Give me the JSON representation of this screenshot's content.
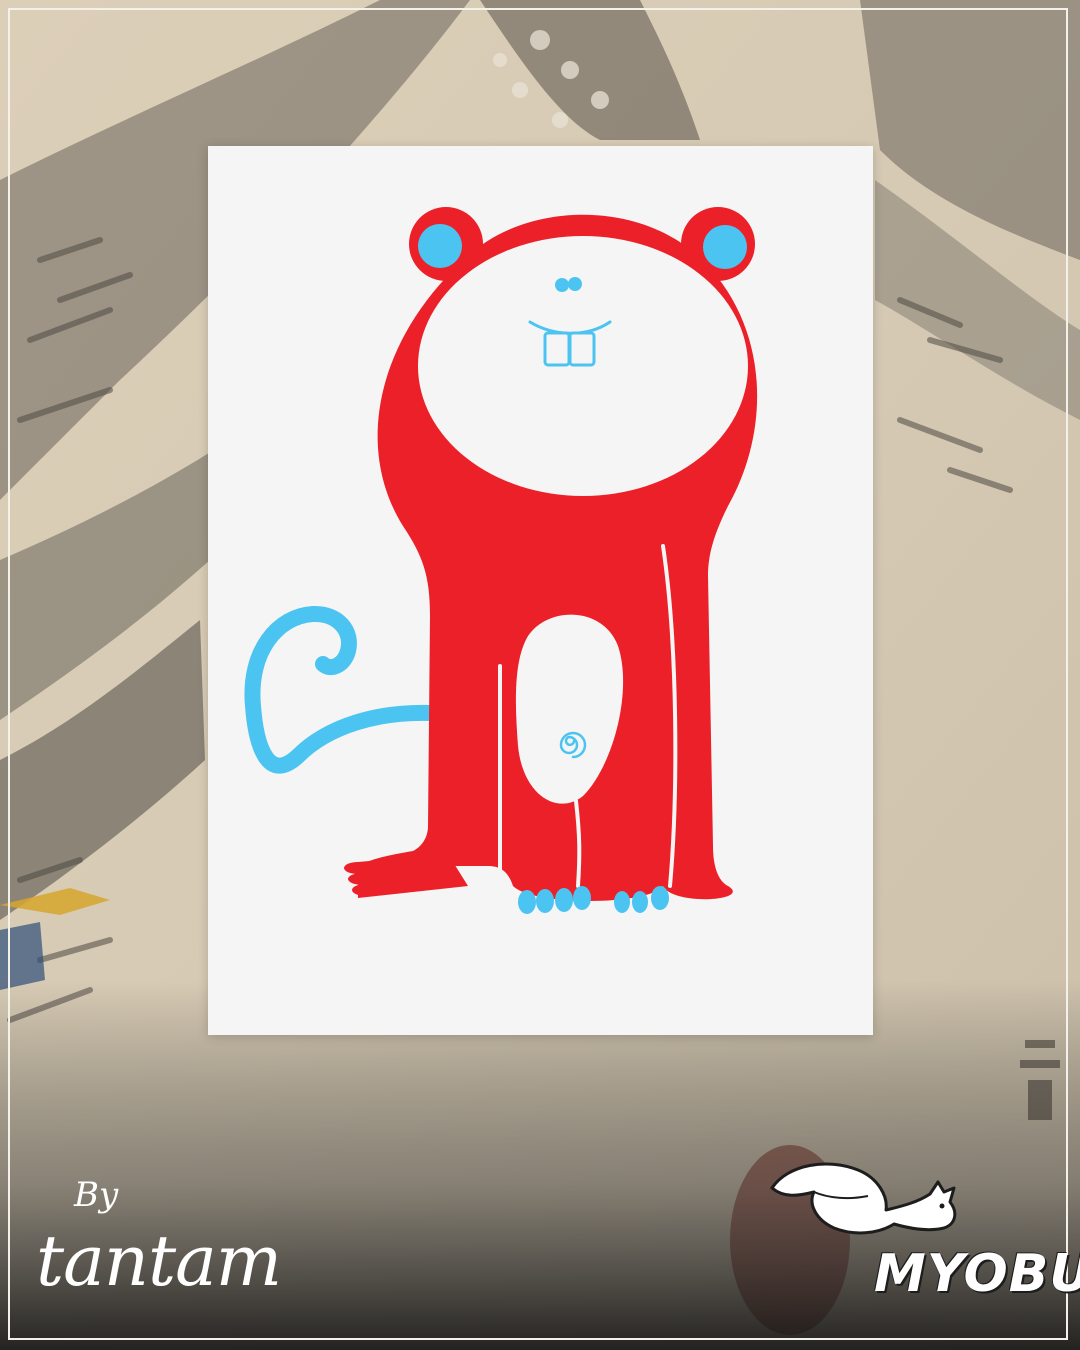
{
  "signature": {
    "by_label": "By",
    "brand_name": "tantam"
  },
  "logo": {
    "text": "MYOBU",
    "icon": "fox-icon"
  },
  "artwork": {
    "subject": "monkey-illustration",
    "colors": {
      "body": "#ec2028",
      "accent": "#4cc4f1",
      "card": "#f5f5f5"
    }
  },
  "background": {
    "style": "woodblock-print-snowy-landscape"
  }
}
